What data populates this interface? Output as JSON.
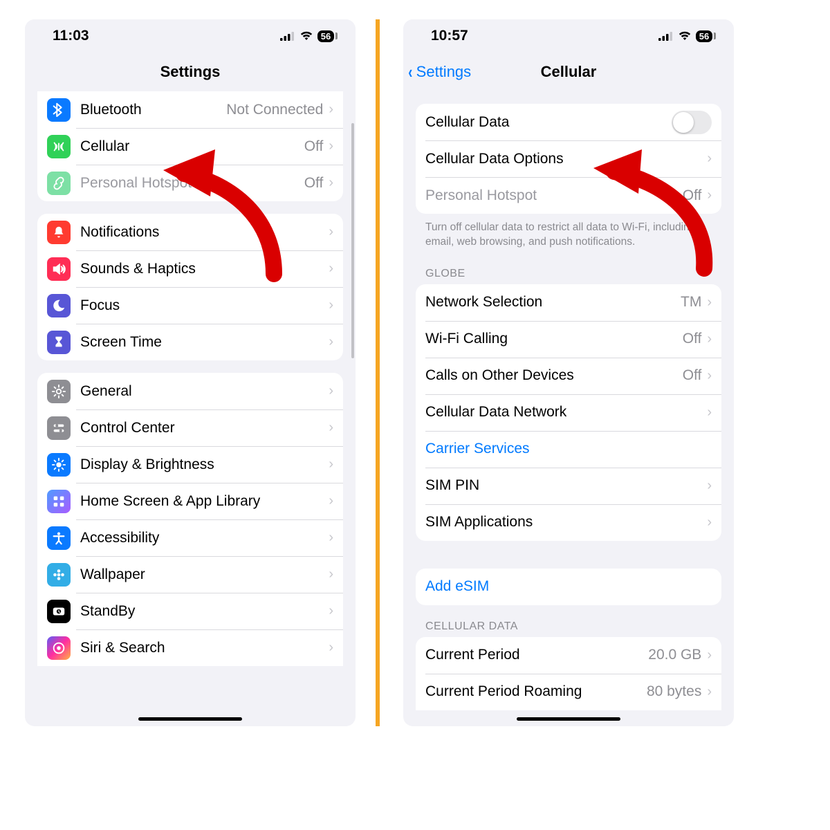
{
  "left": {
    "status": {
      "time": "11:03",
      "battery": "56"
    },
    "title": "Settings",
    "group1": [
      {
        "icon": "bluetooth-icon",
        "bg": "bg-blue",
        "glyph": "BT",
        "label": "Bluetooth",
        "value": "Not Connected"
      },
      {
        "icon": "cellular-icon",
        "bg": "bg-green",
        "glyph": "ANT",
        "label": "Cellular",
        "value": "Off"
      },
      {
        "icon": "hotspot-icon",
        "bg": "bg-green2",
        "glyph": "LINK",
        "label": "Personal Hotspot",
        "value": "Off",
        "dim": true
      }
    ],
    "group2": [
      {
        "icon": "notifications-icon",
        "bg": "bg-red",
        "glyph": "BELL",
        "label": "Notifications"
      },
      {
        "icon": "sounds-icon",
        "bg": "bg-pink",
        "glyph": "SPKR",
        "label": "Sounds & Haptics"
      },
      {
        "icon": "focus-icon",
        "bg": "bg-indigo",
        "glyph": "MOON",
        "label": "Focus"
      },
      {
        "icon": "screentime-icon",
        "bg": "bg-indigo",
        "glyph": "HOUR",
        "label": "Screen Time"
      }
    ],
    "group3": [
      {
        "icon": "general-icon",
        "bg": "bg-gray",
        "glyph": "GEAR",
        "label": "General"
      },
      {
        "icon": "controlcenter-icon",
        "bg": "bg-gray",
        "glyph": "SLID",
        "label": "Control Center"
      },
      {
        "icon": "display-icon",
        "bg": "bg-blue",
        "glyph": "SUN",
        "label": "Display & Brightness"
      },
      {
        "icon": "homescreen-icon",
        "bg": "bg-grid",
        "glyph": "GRID",
        "label": "Home Screen & App Library"
      },
      {
        "icon": "accessibility-icon",
        "bg": "bg-blue",
        "glyph": "ACC",
        "label": "Accessibility"
      },
      {
        "icon": "wallpaper-icon",
        "bg": "bg-cyan",
        "glyph": "FLWR",
        "label": "Wallpaper"
      },
      {
        "icon": "standby-icon",
        "bg": "bg-black",
        "glyph": "CLCK",
        "label": "StandBy"
      },
      {
        "icon": "siri-icon",
        "bg": "bg-siri",
        "glyph": "SIRI",
        "label": "Siri & Search"
      }
    ]
  },
  "right": {
    "status": {
      "time": "10:57",
      "battery": "56"
    },
    "back": "Settings",
    "title": "Cellular",
    "group1": {
      "cellular_data": "Cellular Data",
      "cellular_data_options": "Cellular Data Options",
      "personal_hotspot": "Personal Hotspot",
      "personal_hotspot_value": "Off"
    },
    "footer1": "Turn off cellular data to restrict all data to Wi-Fi, including email, web browsing, and push notifications.",
    "header2": "GLOBE",
    "group2": [
      {
        "label": "Network Selection",
        "value": "TM"
      },
      {
        "label": "Wi-Fi Calling",
        "value": "Off"
      },
      {
        "label": "Calls on Other Devices",
        "value": "Off"
      },
      {
        "label": "Cellular Data Network",
        "value": ""
      },
      {
        "label": "Carrier Services",
        "value": "",
        "link": true,
        "nochev": true
      },
      {
        "label": "SIM PIN",
        "value": ""
      },
      {
        "label": "SIM Applications",
        "value": ""
      }
    ],
    "group3": {
      "add_esim": "Add eSIM"
    },
    "header4": "CELLULAR DATA",
    "group4": [
      {
        "label": "Current Period",
        "value": "20.0 GB"
      },
      {
        "label": "Current Period Roaming",
        "value": "80 bytes"
      }
    ]
  }
}
